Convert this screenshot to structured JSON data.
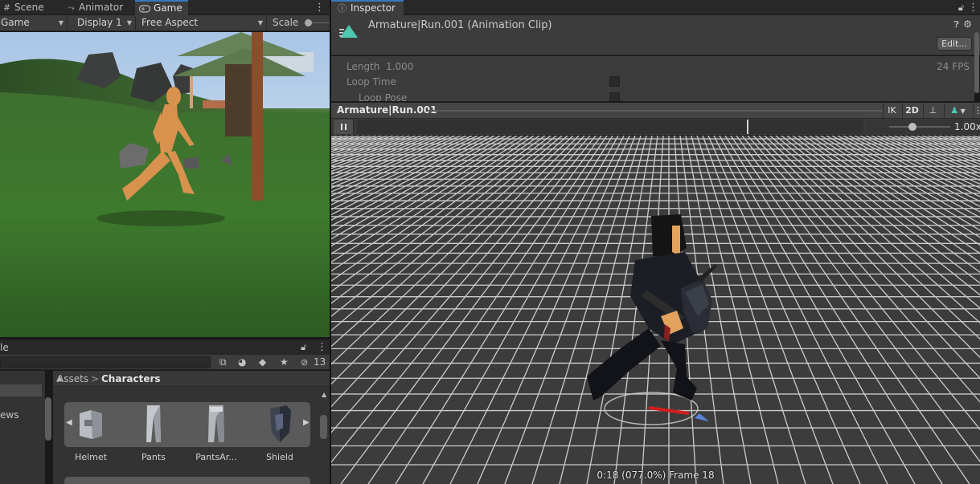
{
  "left_tabs": {
    "scene": "Scene",
    "animator": "Animator",
    "game": "Game"
  },
  "game_toolbar": {
    "mode": "Game",
    "display": "Display 1",
    "aspect": "Free Aspect",
    "scale_label": "Scale"
  },
  "project": {
    "panel_title_fragment": "le",
    "filter_count": "13",
    "sidebar_fragment": "ews",
    "breadcrumb": {
      "root": "Assets",
      "separator": ">",
      "current": "Characters"
    },
    "assets": [
      {
        "name": "Helmet"
      },
      {
        "name": "Pants"
      },
      {
        "name": "PantsAr..."
      },
      {
        "name": "Shield"
      }
    ]
  },
  "inspector": {
    "tab_label": "Inspector",
    "clip_title": "Armature|Run.001 (Animation Clip)",
    "edit_label": "Edit...",
    "length_label": "Length",
    "length_value": "1.000",
    "fps_label": "24 FPS",
    "loop_time_label": "Loop Time",
    "loop_pose_label": "Loop Pose"
  },
  "preview": {
    "clip_name": "Armature|Run.001",
    "ik_label": "IK",
    "twod_label": "2D",
    "speed_label": "1.00x",
    "speed_value": 0.38,
    "status": "0:18 (077.0%) Frame 18"
  },
  "colors": {
    "active_tab_accent": "#3a79bb",
    "avatar_icon": "#4cc9b0",
    "grid_line": "#e6e6e6",
    "character_skin": "#e3a35f"
  },
  "icons": [
    "hash-icon",
    "animator-icon",
    "gamepad-icon",
    "kebab-icon",
    "info-icon",
    "lock-icon",
    "help-icon",
    "pause-icon",
    "avatar-icon",
    "star-icon",
    "label-icon",
    "visibility-icon"
  ]
}
